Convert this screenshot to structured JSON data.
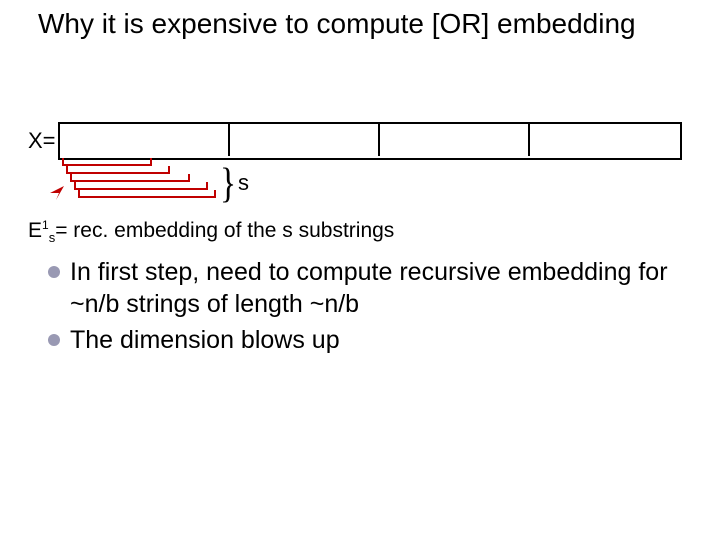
{
  "title": "Why it is expensive to compute [OR] embedding",
  "x_label": "X=",
  "s_label": "s",
  "e1s_prefix": "E",
  "e1s_sup": "1",
  "e1s_sub": "s",
  "e1s_rest": "= rec. embedding of the s substrings",
  "bullets": [
    "In first step, need to compute recursive embedding for ~n/b strings of length ~n/b",
    "The dimension blows up"
  ]
}
